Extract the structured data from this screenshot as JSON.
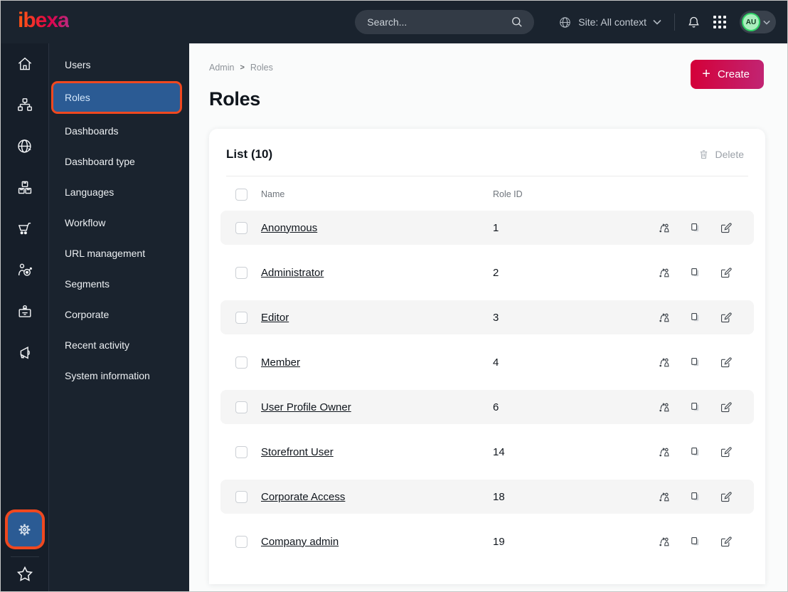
{
  "topbar": {
    "logo": "ibexa",
    "search": {
      "placeholder": "Search..."
    },
    "site_context": "Site: All context",
    "avatar_initials": "AU",
    "icons": [
      "globe-icon",
      "chevron-down-icon",
      "bell-icon",
      "app-grid-icon",
      "search-icon"
    ]
  },
  "icon_rail": {
    "icons": [
      "home-icon",
      "content-tree-icon",
      "site-globe-icon",
      "product-boxes-icon",
      "cart-icon",
      "personalization-target-icon",
      "customer-badge-icon",
      "megaphone-icon",
      "gear-icon",
      "star-icon"
    ],
    "active": "gear-icon"
  },
  "sidebar": {
    "items": [
      "Users",
      "Roles",
      "Dashboards",
      "Dashboard type",
      "Languages",
      "Workflow",
      "URL management",
      "Segments",
      "Corporate",
      "Recent activity",
      "System information"
    ],
    "active": "Roles"
  },
  "breadcrumb": {
    "items": [
      "Admin",
      "Roles"
    ],
    "separator": ">"
  },
  "header": {
    "title": "Roles",
    "create_label": "Create"
  },
  "list": {
    "title": "List (10)",
    "delete_label": "Delete",
    "columns": {
      "name": "Name",
      "role_id": "Role ID"
    },
    "row_action_icons": [
      "assign-user-icon",
      "copy-icon",
      "edit-icon"
    ],
    "rows": [
      {
        "name": "Anonymous",
        "role_id": "1"
      },
      {
        "name": "Administrator",
        "role_id": "2"
      },
      {
        "name": "Editor",
        "role_id": "3"
      },
      {
        "name": "Member",
        "role_id": "4"
      },
      {
        "name": "User Profile Owner",
        "role_id": "6"
      },
      {
        "name": "Storefront User",
        "role_id": "14"
      },
      {
        "name": "Corporate Access",
        "role_id": "18"
      },
      {
        "name": "Company admin",
        "role_id": "19"
      }
    ]
  },
  "colors": {
    "topbar_bg": "#1a232e",
    "accent_orange": "#f0481f",
    "selected_blue": "#2b5b94",
    "create_gradient_from": "#d40038",
    "create_gradient_to": "#c12574",
    "avatar_green": "#2fd165",
    "row_stripe": "#f5f5f5"
  }
}
